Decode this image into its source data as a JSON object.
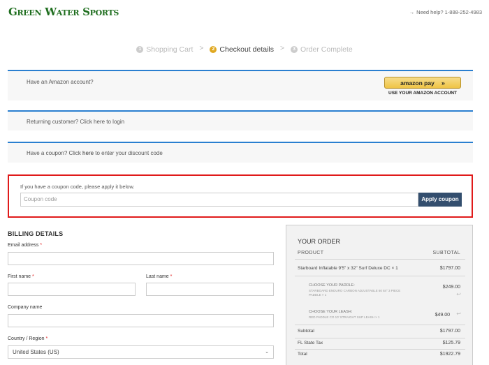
{
  "header": {
    "logo_text": "Green Water Sports",
    "help_arrow": "→",
    "help_text": "Need help? 1-888-252-4983"
  },
  "steps": [
    {
      "num": "1",
      "label": "Shopping Cart"
    },
    {
      "num": "2",
      "label": "Checkout details"
    },
    {
      "num": "3",
      "label": "Order Complete"
    }
  ],
  "step_separator": ">",
  "amazon": {
    "question": "Have an Amazon account?",
    "button_label": "amazon pay",
    "button_chevron": "»",
    "caption": "USE YOUR AMAZON ACCOUNT"
  },
  "login_notice": {
    "prefix": "Returning customer? ",
    "link": "Click here to login"
  },
  "coupon_notice": {
    "prefix": "Have a coupon? Click ",
    "link": "here",
    "suffix": " to enter your discount code"
  },
  "coupon_form": {
    "hint": "If you have a coupon code, please apply it below.",
    "placeholder": "Coupon code",
    "button": "Apply coupon"
  },
  "billing": {
    "title": "BILLING DETAILS",
    "required_mark": "*",
    "email_label": "Email address",
    "first_name_label": "First name",
    "last_name_label": "Last name",
    "company_label": "Company name",
    "country_label": "Country / Region",
    "country_value": "United States (US)",
    "country_caret": "⌄"
  },
  "order": {
    "title": "YOUR ORDER",
    "col_product": "PRODUCT",
    "col_subtotal": "SUBTOTAL",
    "item_name": "Starboard Inflatable 9'5\" x 32\" Surf Deluxe DC  × 1",
    "item_price": "$1797.00",
    "addon1_title": "CHOOSE YOUR PADDLE:",
    "addon1_line1": "STARBOARD ENDURO CARBON ADJUSTABLE 60 84\" 3 PIECE",
    "addon1_line2": "PADDLE × 1",
    "addon1_price": "$249.00",
    "addon2_title": "CHOOSE YOUR LEASH:",
    "addon2_line1": "RED PADDLE CO 10' STRAIGHT SUP LEASH × 1",
    "addon2_price": "$49.00",
    "undo_icon": "↩",
    "subtotal_label": "Subtotal",
    "subtotal_value": "$1797.00",
    "tax_label": "FL State Tax",
    "tax_value": "$125.79",
    "total_label": "Total",
    "total_value": "$1922.79"
  },
  "colors": {
    "accent_blue": "#2a7fd0",
    "highlight_red": "#e01a1a",
    "button_navy": "#334e6e",
    "logo_green": "#1f6e1f",
    "amazon_gold": "#efc445"
  }
}
